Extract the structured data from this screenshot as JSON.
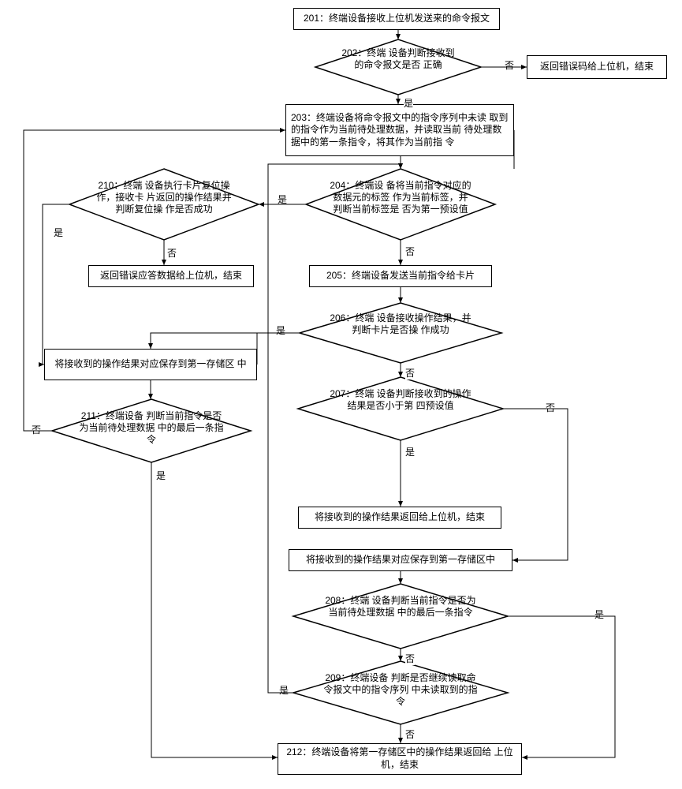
{
  "chart_data": {
    "type": "flowchart",
    "nodes": [
      {
        "id": "n201",
        "shape": "rect",
        "text": "201：终端设备接收上位机发送来的命令报文"
      },
      {
        "id": "n202",
        "shape": "diamond",
        "text": "202：终端\n设备判断接收到的命令报文是否\n正确"
      },
      {
        "id": "err202",
        "shape": "rect",
        "text": "返回错误码给上位机，结束"
      },
      {
        "id": "n203",
        "shape": "rect",
        "text": "203：终端设备将命令报文中的指令序列中未读\n取到的指令作为当前待处理数据，并读取当前\n待处理数据中的第一条指令，将其作为当前指\n令"
      },
      {
        "id": "n204",
        "shape": "diamond",
        "text": "204：终端设\n备将当前指令对应的数据元的标签\n作为当前标签，并判断当前标签是\n否为第一预设值"
      },
      {
        "id": "n210",
        "shape": "diamond",
        "text": "210：终端\n设备执行卡片复位操作，接收卡\n片返回的操作结果并判断复位操\n作是否成功"
      },
      {
        "id": "err210",
        "shape": "rect",
        "text": "返回错误应答数据给上位机，结束"
      },
      {
        "id": "n205",
        "shape": "rect",
        "text": "205：终端设备发送当前指令给卡片"
      },
      {
        "id": "n206",
        "shape": "diamond",
        "text": "206：终端\n设备接收操作结果，并判断卡片是否操\n作成功"
      },
      {
        "id": "save1",
        "shape": "rect",
        "text": "将接收到的操作结果对应保存到第一存储区\n中"
      },
      {
        "id": "n211",
        "shape": "diamond",
        "text": "211：终端设备\n判断当前指令是否为当前待处理数据\n中的最后一条指令"
      },
      {
        "id": "n207",
        "shape": "diamond",
        "text": "207：终端\n设备判断接收到的操作结果是否小于第\n四预设值"
      },
      {
        "id": "ret207",
        "shape": "rect",
        "text": "将接收到的操作结果返回给上位机，结束"
      },
      {
        "id": "save2",
        "shape": "rect",
        "text": "将接收到的操作结果对应保存到第一存储区中"
      },
      {
        "id": "n208",
        "shape": "diamond",
        "text": "208：终端\n设备判断当前指令是否为当前待处理数据\n中的最后一条指令"
      },
      {
        "id": "n209",
        "shape": "diamond",
        "text": "209：终端设备\n判断是否继续读取命令报文中的指令序列\n中未读取到的指令"
      },
      {
        "id": "n212",
        "shape": "rect",
        "text": "212：终端设备将第一存储区中的操作结果返回给\n上位机，结束"
      }
    ],
    "edges": [
      {
        "from": "n201",
        "to": "n202"
      },
      {
        "from": "n202",
        "to": "err202",
        "label": "否"
      },
      {
        "from": "n202",
        "to": "n203",
        "label": "是"
      },
      {
        "from": "n203",
        "to": "n204"
      },
      {
        "from": "n204",
        "to": "n210",
        "label": "是"
      },
      {
        "from": "n204",
        "to": "n205",
        "label": "否"
      },
      {
        "from": "n205",
        "to": "n206"
      },
      {
        "from": "n206",
        "to": "save1",
        "label": "是"
      },
      {
        "from": "n206",
        "to": "n207",
        "label": "否"
      },
      {
        "from": "save1",
        "to": "n211"
      },
      {
        "from": "n211",
        "to": "n203",
        "label": "否"
      },
      {
        "from": "n211",
        "to": "n212",
        "label": "是"
      },
      {
        "from": "n210",
        "to": "err210",
        "label": "否"
      },
      {
        "from": "n210",
        "to": "save1",
        "label": "是"
      },
      {
        "from": "n207",
        "to": "ret207",
        "label": "是"
      },
      {
        "from": "n207",
        "to": "save2",
        "label": "否 (→)"
      },
      {
        "from": "save2",
        "to": "n208"
      },
      {
        "from": "n208",
        "to": "n209",
        "label": "否"
      },
      {
        "from": "n208",
        "to": "n212",
        "label": "是"
      },
      {
        "from": "n209",
        "to": "n203",
        "label": "是"
      },
      {
        "from": "n209",
        "to": "n212",
        "label": "否"
      }
    ]
  },
  "labels": {
    "yes": "是",
    "no": "否"
  }
}
